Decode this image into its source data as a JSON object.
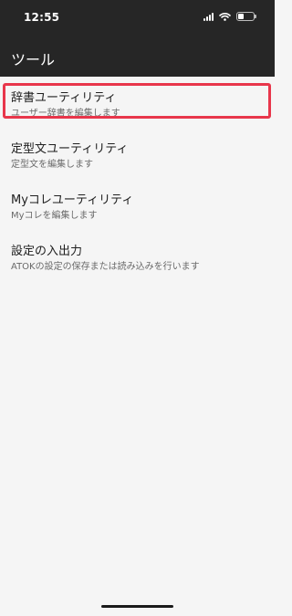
{
  "status_bar": {
    "time": "12:55",
    "battery_level": 0.4,
    "icons": [
      "signal-icon",
      "wifi-icon",
      "battery-icon"
    ]
  },
  "header": {
    "title": "ツール"
  },
  "items": [
    {
      "label": "辞書ユーティリティ",
      "description": "ユーザー辞書を編集します",
      "highlighted": true
    },
    {
      "label": "定型文ユーティリティ",
      "description": "定型文を編集します"
    },
    {
      "label": "Myコレユーティリティ",
      "description": "Myコレを編集します"
    },
    {
      "label": "設定の入出力",
      "description": "ATOKの設定の保存または読み込みを行います"
    }
  ],
  "colors": {
    "header_bg": "#262626",
    "page_bg": "#f5f5f5",
    "highlight": "#e8364b"
  }
}
